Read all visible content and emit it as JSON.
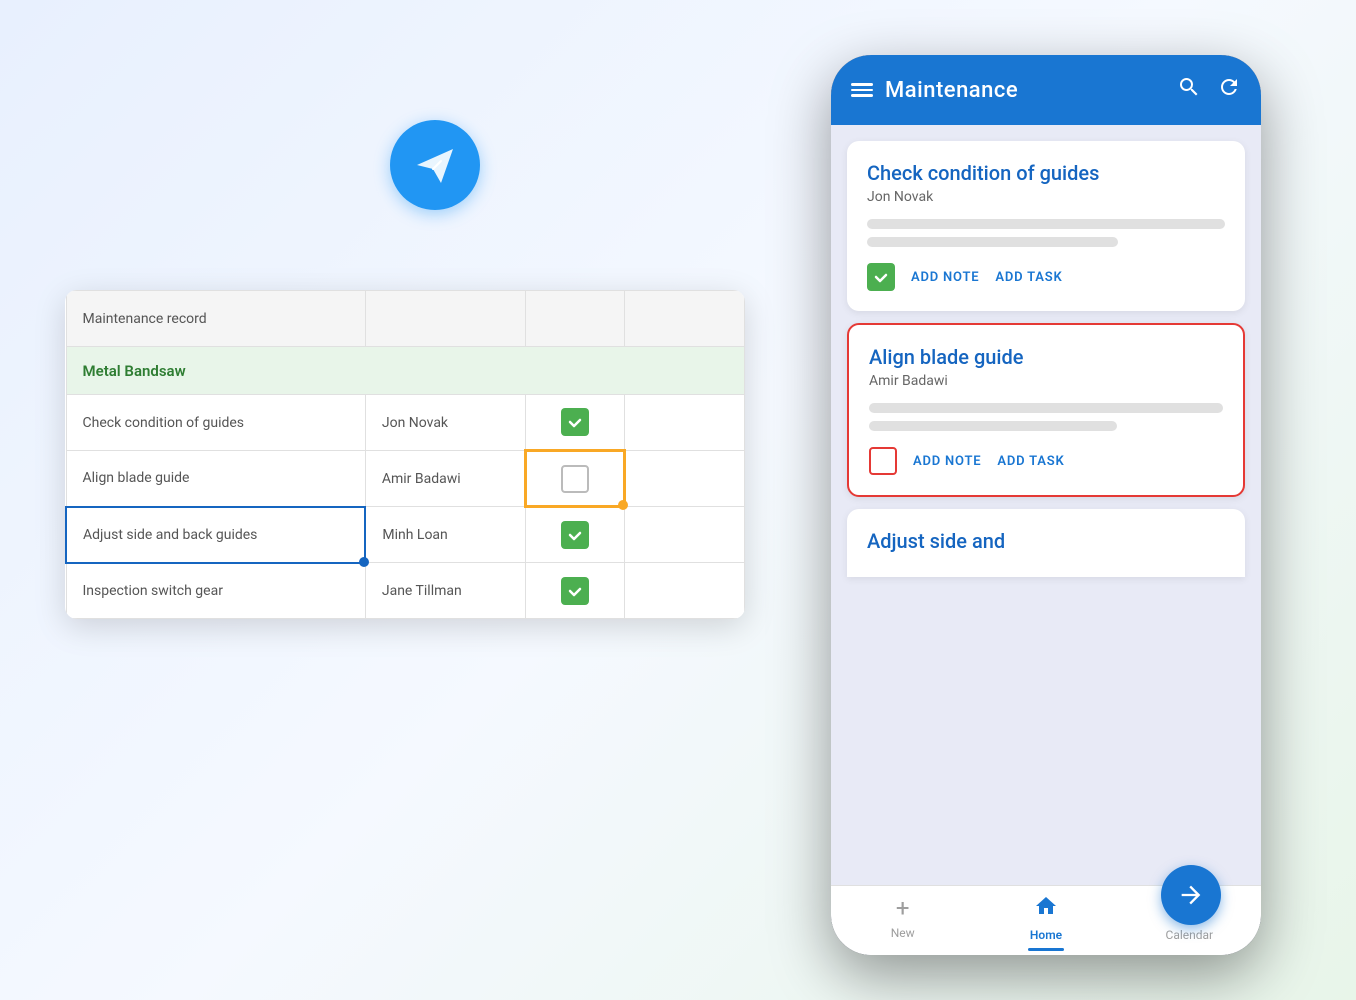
{
  "background": {
    "color": "#f0f4f8"
  },
  "paperPlane": {
    "label": "Paper plane logo"
  },
  "spreadsheet": {
    "headerRow": {
      "col1": "Maintenance record",
      "col2": "",
      "col3": ""
    },
    "sectionRow": {
      "label": "Metal Bandsaw"
    },
    "rows": [
      {
        "task": "Check condition of guides",
        "person": "Jon Novak",
        "checked": true,
        "highlight": ""
      },
      {
        "task": "Align blade guide",
        "person": "Amir Badawi",
        "checked": false,
        "highlight": "yellow"
      },
      {
        "task": "Adjust side and back guides",
        "person": "Minh Loan",
        "checked": true,
        "highlight": "blue"
      },
      {
        "task": "Inspection switch gear",
        "person": "Jane Tillman",
        "checked": true,
        "highlight": ""
      }
    ]
  },
  "mobileApp": {
    "header": {
      "title": "Maintenance",
      "menuIcon": "≡",
      "searchIcon": "🔍",
      "refreshIcon": "↺"
    },
    "cards": [
      {
        "title": "Check condition of guides",
        "person": "Jon Novak",
        "checked": true,
        "borderColor": "none",
        "actions": {
          "note": "ADD NOTE",
          "task": "ADD TASK"
        }
      },
      {
        "title": "Align blade guide",
        "person": "Amir Badawi",
        "checked": false,
        "borderColor": "red",
        "actions": {
          "note": "ADD NOTE",
          "task": "ADD TASK"
        }
      },
      {
        "title": "Adjust side and",
        "person": "",
        "partial": true
      }
    ],
    "fab": {
      "icon": "→"
    },
    "bottomNav": {
      "items": [
        {
          "label": "New",
          "icon": "+",
          "active": false
        },
        {
          "label": "Home",
          "icon": "⌂",
          "active": true
        },
        {
          "label": "Calendar",
          "icon": "📅",
          "active": false
        }
      ]
    }
  }
}
